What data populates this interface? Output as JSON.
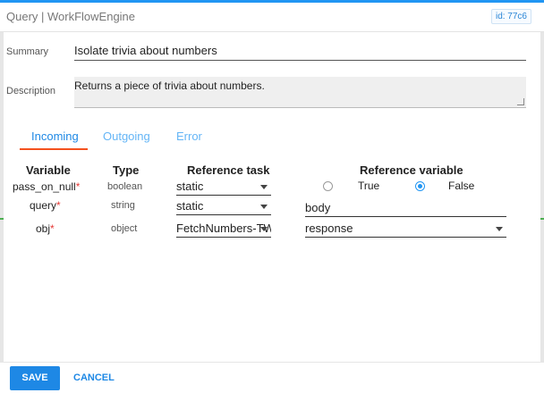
{
  "window": {
    "title": "Query | WorkFlowEngine",
    "id_badge": "id: 77c6"
  },
  "form": {
    "summary_label": "Summary",
    "summary_value": "Isolate trivia about numbers",
    "description_label": "Description",
    "description_value": "Returns a piece of trivia about numbers."
  },
  "tabs": [
    {
      "label": "Incoming",
      "active": true
    },
    {
      "label": "Outgoing",
      "active": false
    },
    {
      "label": "Error",
      "active": false
    }
  ],
  "table": {
    "headers": {
      "variable": "Variable",
      "type": "Type",
      "reference_task": "Reference task",
      "reference_variable": "Reference variable"
    },
    "required_mark": "*",
    "rows": [
      {
        "variable": "pass_on_null",
        "type": "boolean",
        "task": "static",
        "ref_true": "True",
        "ref_false": "False",
        "selected": "False"
      },
      {
        "variable": "query",
        "type": "string",
        "task": "static",
        "ref_value": "body"
      },
      {
        "variable": "obj",
        "type": "object",
        "task": "FetchNumbers-TW",
        "ref_value": "response"
      }
    ]
  },
  "footer": {
    "save_label": "SAVE",
    "cancel_label": "CANCEL"
  },
  "colors": {
    "accent": "#1e88e5",
    "tab_indicator": "#f4511e",
    "required": "#e53935"
  }
}
